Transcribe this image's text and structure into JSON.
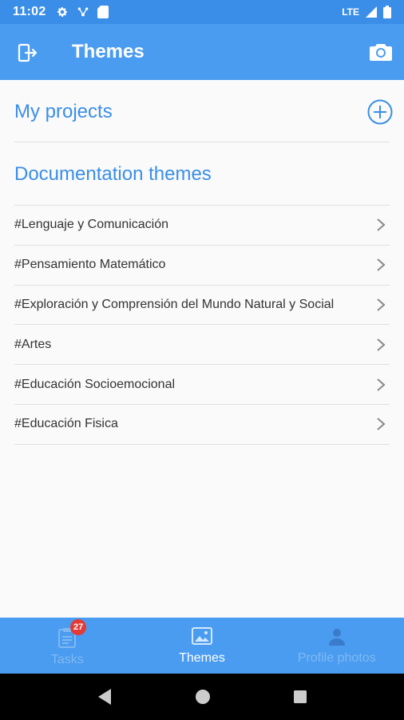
{
  "status_bar": {
    "time": "11:02",
    "network": "LTE"
  },
  "app_bar": {
    "title": "Themes",
    "left_icon": "exit-icon",
    "right_icon": "camera-icon"
  },
  "my_projects": {
    "title": "My projects",
    "add_icon": "plus-circle-icon"
  },
  "documentation": {
    "title": "Documentation themes",
    "items": [
      {
        "label": "#Lenguaje y Comunicación"
      },
      {
        "label": "#Pensamiento Matemático"
      },
      {
        "label": "#Exploración y Comprensión del Mundo Natural y Social"
      },
      {
        "label": "#Artes"
      },
      {
        "label": "#Educación Socioemocional"
      },
      {
        "label": "#Educación Fisica"
      }
    ]
  },
  "bottom_nav": {
    "tasks": {
      "label": "Tasks",
      "badge": "27"
    },
    "themes": {
      "label": "Themes"
    },
    "profile": {
      "label": "Profile photos"
    }
  },
  "colors": {
    "primary": "#4a9cf0",
    "accent_text": "#3a8ee8",
    "badge": "#e53935"
  }
}
